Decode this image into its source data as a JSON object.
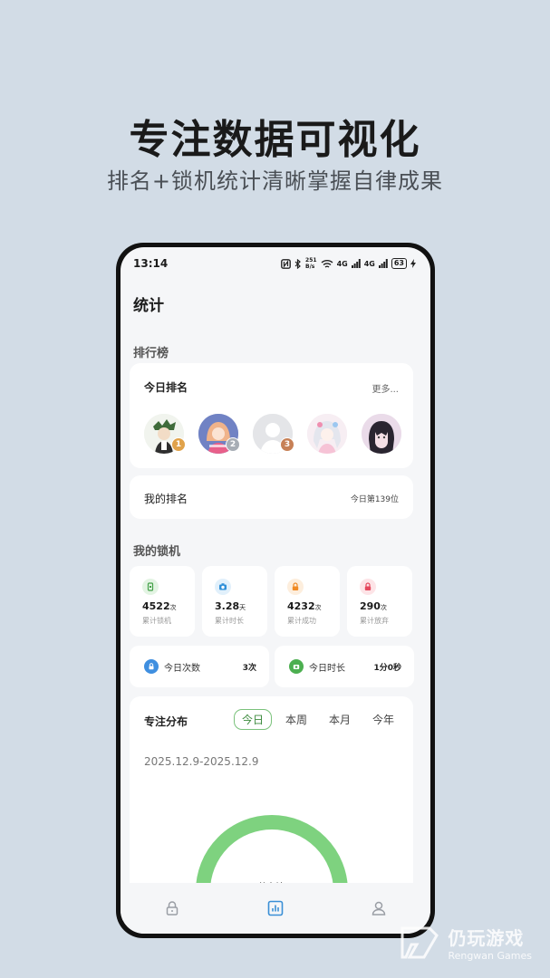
{
  "promo": {
    "headline": "专注数据可视化",
    "subline": "排名+锁机统计清晰掌握自律成果"
  },
  "statusbar": {
    "time": "13:14",
    "net_speed": "251\nB/s",
    "signal1": "4G",
    "signal2": "4G",
    "battery": "63"
  },
  "page": {
    "title": "统计"
  },
  "ranking": {
    "section_label": "排行榜",
    "today_title": "今日排名",
    "more": "更多...",
    "avatars": [
      {
        "rank": "1",
        "badge_color": "#e0a24a"
      },
      {
        "rank": "2",
        "badge_color": "#a7adb5"
      },
      {
        "rank": "3",
        "badge_color": "#c78056"
      },
      {
        "rank": "",
        "badge_color": ""
      },
      {
        "rank": "",
        "badge_color": ""
      }
    ],
    "my_rank_label": "我的排名",
    "my_rank_value": "今日第139位"
  },
  "lock": {
    "section_label": "我的锁机",
    "stats": [
      {
        "value": "4522",
        "unit": "次",
        "label": "累计锁机",
        "icon": "phone-lock-icon",
        "icon_bg": "#e3f4e3",
        "icon_color": "#43a047"
      },
      {
        "value": "3.28",
        "unit": "天",
        "label": "累计时长",
        "icon": "clock-icon",
        "icon_bg": "#e1f0fb",
        "icon_color": "#2e8fd8"
      },
      {
        "value": "4232",
        "unit": "次",
        "label": "累计成功",
        "icon": "success-lock-icon",
        "icon_bg": "#fdeedd",
        "icon_color": "#f08a24"
      },
      {
        "value": "290",
        "unit": "次",
        "label": "累计放弃",
        "icon": "give-up-lock-icon",
        "icon_bg": "#fde4e7",
        "icon_color": "#e5485d"
      }
    ],
    "today_count_label": "今日次数",
    "today_count_value": "3次",
    "today_time_label": "今日时长",
    "today_time_value": "1分0秒"
  },
  "focus": {
    "title": "专注分布",
    "tabs": [
      "今日",
      "本周",
      "本月",
      "今年"
    ],
    "active_tab": 0,
    "date_range": "2025.12.9-2025.12.9",
    "donut_label": "共专注",
    "donut_color": "#7ed27f"
  },
  "bottom_nav": [
    "lock-nav-icon",
    "stats-nav-icon",
    "profile-nav-icon"
  ],
  "watermark": {
    "cn": "仍玩游戏",
    "en": "Rengwan Games"
  }
}
